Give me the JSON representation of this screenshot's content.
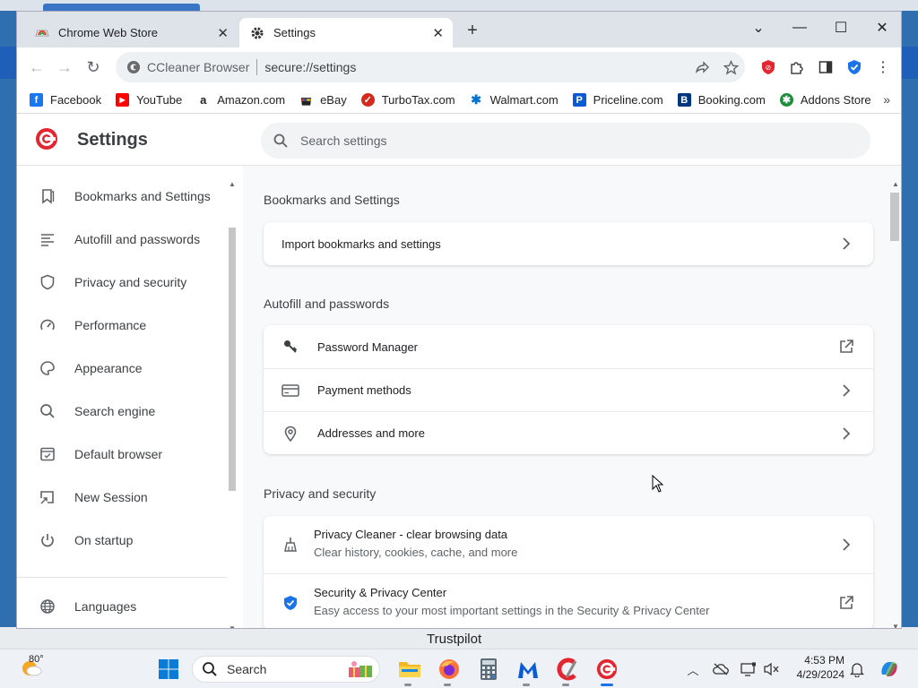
{
  "tabs": [
    {
      "title": "Chrome Web Store"
    },
    {
      "title": "Settings"
    }
  ],
  "omnibox": {
    "brand": "CCleaner Browser",
    "url": "secure://settings"
  },
  "bookmarks": [
    {
      "label": "Facebook",
      "icon": "facebook-icon",
      "color": "#1877f2",
      "glyph": "f"
    },
    {
      "label": "YouTube",
      "icon": "youtube-icon",
      "color": "#ff0000",
      "glyph": "▶"
    },
    {
      "label": "Amazon.com",
      "icon": "amazon-icon",
      "color": "#222222",
      "glyph": "a"
    },
    {
      "label": "eBay",
      "icon": "ebay-icon",
      "color": "#e53238",
      "glyph": "e"
    },
    {
      "label": "TurboTax.com",
      "icon": "turbotax-icon",
      "color": "#d52b1e",
      "glyph": "✓"
    },
    {
      "label": "Walmart.com",
      "icon": "walmart-icon",
      "color": "#0071ce",
      "glyph": "✱"
    },
    {
      "label": "Priceline.com",
      "icon": "priceline-icon",
      "color": "#0a5ad4",
      "glyph": "P"
    },
    {
      "label": "Booking.com",
      "icon": "booking-icon",
      "color": "#003580",
      "glyph": "B"
    },
    {
      "label": "Addons Store",
      "icon": "addons-store-icon",
      "color": "#1e8e3e",
      "glyph": "✱"
    }
  ],
  "settings": {
    "title": "Settings",
    "search_placeholder": "Search settings"
  },
  "sidebar": {
    "items": [
      {
        "label": "Bookmarks and Settings",
        "icon": "bookmark-icon"
      },
      {
        "label": "Autofill and passwords",
        "icon": "autofill-icon"
      },
      {
        "label": "Privacy and security",
        "icon": "shield-icon"
      },
      {
        "label": "Performance",
        "icon": "speedometer-icon"
      },
      {
        "label": "Appearance",
        "icon": "palette-icon"
      },
      {
        "label": "Search engine",
        "icon": "search-icon"
      },
      {
        "label": "Default browser",
        "icon": "browser-window-icon"
      },
      {
        "label": "New Session",
        "icon": "new-session-icon"
      },
      {
        "label": "On startup",
        "icon": "power-icon"
      },
      {
        "label": "Languages",
        "icon": "globe-icon"
      }
    ]
  },
  "sections": {
    "bookmarks": {
      "heading": "Bookmarks and Settings",
      "rows": [
        {
          "label": "Import bookmarks and settings"
        }
      ]
    },
    "autofill": {
      "heading": "Autofill and passwords",
      "rows": [
        {
          "label": "Password Manager",
          "icon": "key-icon"
        },
        {
          "label": "Payment methods",
          "icon": "credit-card-icon"
        },
        {
          "label": "Addresses and more",
          "icon": "location-pin-icon"
        }
      ]
    },
    "privacy": {
      "heading": "Privacy and security",
      "rows": [
        {
          "label": "Privacy Cleaner - clear browsing data",
          "sub": "Clear history, cookies, cache, and more",
          "icon": "broom-icon"
        },
        {
          "label": "Security & Privacy Center",
          "sub": "Easy access to your most important settings in the Security & Privacy Center",
          "icon": "security-shield-icon"
        }
      ]
    }
  },
  "background_text": "Trustpilot",
  "taskbar": {
    "weather_temp": "80°",
    "search_label": "Search",
    "time": "4:53 PM",
    "date": "4/29/2024"
  },
  "colors": {
    "accent": "#1a73e8",
    "ccleaner_red": "#e3262f"
  }
}
